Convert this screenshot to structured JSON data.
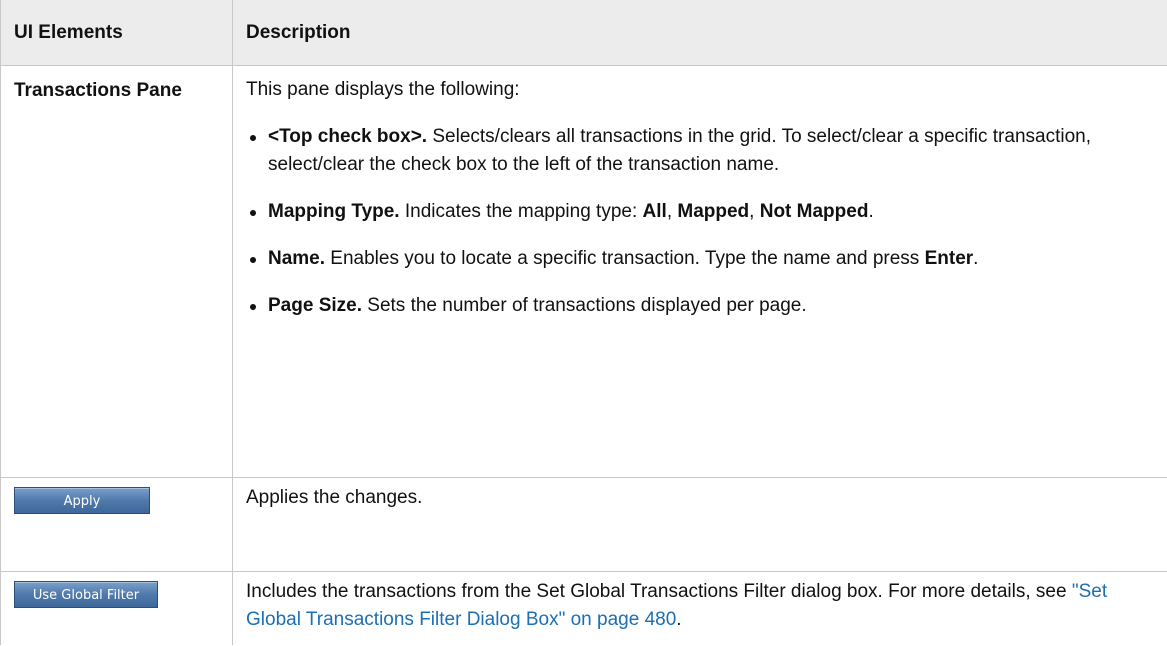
{
  "table": {
    "header": {
      "col1": "UI Elements",
      "col2": "Description"
    },
    "rows": {
      "transactions": {
        "name": "Transactions Pane",
        "intro": "This pane displays the following:",
        "items": [
          {
            "term": "<Top check box>.",
            "text": " Selects/clears all transactions in the grid. To select/clear a specific transaction, select/clear the check box to the left of the transaction name."
          },
          {
            "term": "Mapping Type.",
            "text": " Indicates the mapping type: ",
            "opt1": "All",
            "sep1": ", ",
            "opt2": "Mapped",
            "sep2": ", ",
            "opt3": "Not Mapped",
            "end": "."
          },
          {
            "term": "Name.",
            "text": " Enables you to locate a specific transaction. Type the name and press ",
            "key": "Enter",
            "end": "."
          },
          {
            "term": "Page Size.",
            "text": " Sets the number of transactions displayed per page."
          }
        ]
      },
      "apply": {
        "button_label": "Apply",
        "description": "Applies the changes."
      },
      "global_filter": {
        "button_label": "Use Global Filter",
        "description": "Includes the transactions from the Set Global Transactions Filter dialog box. For more details, see ",
        "link_text": "\"Set Global Transactions Filter Dialog Box\" on page 480",
        "end": "."
      }
    }
  }
}
